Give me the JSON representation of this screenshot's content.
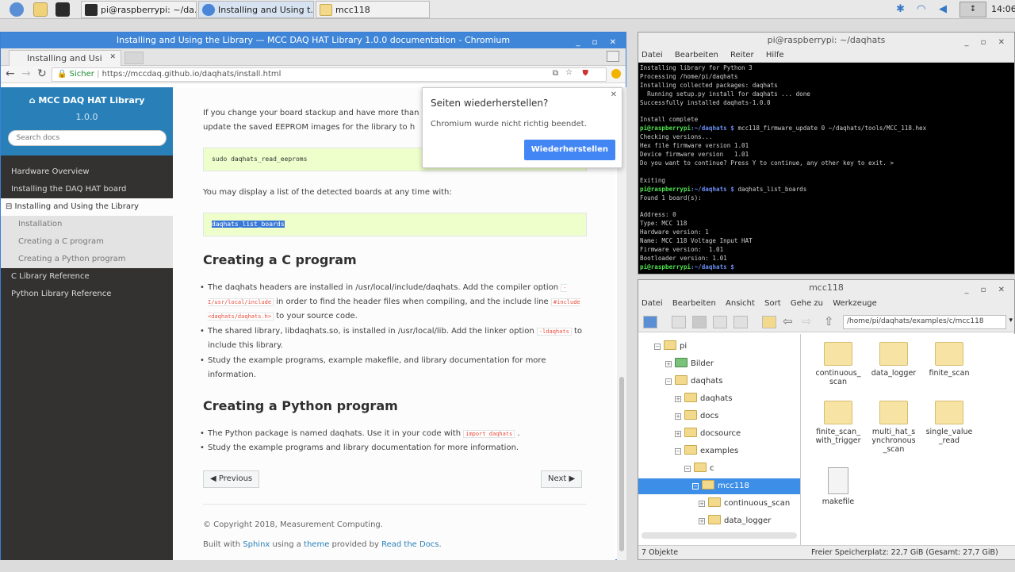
{
  "taskbar": {
    "tasks": [
      {
        "label": "pi@raspberrypi: ~/da..."
      },
      {
        "label": "Installing and Using t..."
      },
      {
        "label": "mcc118"
      }
    ],
    "clock": "14:06",
    "tray_text": "↕"
  },
  "browser": {
    "window_title": "Installing and Using the Library — MCC DAQ HAT Library 1.0.0 documentation - Chromium",
    "tab_label": "Installing and Usi",
    "secure_label": "Sicher",
    "url": "https://mccdaq.github.io/daqhats/install.html",
    "sidebar": {
      "title": "MCC DAQ HAT Library",
      "version": "1.0.0",
      "search_placeholder": "Search docs",
      "items": [
        {
          "label": "Hardware Overview"
        },
        {
          "label": "Installing the DAQ HAT board"
        },
        {
          "label": "⊟ Installing and Using the Library"
        }
      ],
      "sub_items": [
        {
          "label": "Installation"
        },
        {
          "label": "Creating a C program"
        },
        {
          "label": "Creating a Python program"
        }
      ],
      "items2": [
        {
          "label": "C Library Reference"
        },
        {
          "label": "Python Library Reference"
        }
      ]
    },
    "content": {
      "intro_line1": "If you change your board stackup and have more than",
      "intro_line2": "update the saved EEPROM images for the library to h",
      "code1": "sudo daqhats_read_eeproms",
      "list_text": "You may display a list of the detected boards at any time with:",
      "code2": "daqhats_list_boards",
      "h_c": "Creating a C program",
      "c_bullets": [
        {
          "a": "The daqhats headers are installed in /usr/local/include/daqhats. Add the compiler option",
          "code": "-I/usr/local/include",
          "b": "in order to find the header files when compiling, and the include line",
          "code2": "#include <daqhats/daqhats.h>",
          "c": "to your source code."
        },
        {
          "a": "The shared library, libdaqhats.so, is installed in /usr/local/lib. Add the linker option",
          "code": "-ldaqhats",
          "b": "to include this library."
        },
        {
          "a": "Study the example programs, example makefile, and library documentation for more information."
        }
      ],
      "h_py": "Creating a Python program",
      "py_bullets": [
        {
          "a": "The Python package is named daqhats. Use it in your code with",
          "code": "import daqhats",
          "b": "."
        },
        {
          "a": "Study the example programs and library documentation for more information."
        }
      ],
      "prev_label": "Previous",
      "next_label": "Next",
      "copyright": "© Copyright 2018, Measurement Computing.",
      "built_pre": "Built with",
      "built_sphinx": "Sphinx",
      "built_mid": "using a",
      "built_theme": "theme",
      "built_mid2": "provided by",
      "built_rtd": "Read the Docs",
      "built_end": "."
    },
    "popup": {
      "title": "Seiten wiederherstellen?",
      "message": "Chromium wurde nicht richtig beendet.",
      "button": "Wiederherstellen"
    }
  },
  "terminal": {
    "title": "pi@raspberrypi: ~/daqhats",
    "menu": [
      {
        "label": "Datei"
      },
      {
        "label": "Bearbeiten"
      },
      {
        "label": "Reiter"
      },
      {
        "label": "Hilfe"
      }
    ],
    "lines": [
      {
        "text": "Installing library for Python 3"
      },
      {
        "text": "Processing /home/pi/daqhats"
      },
      {
        "text": "Installing collected packages: daqhats"
      },
      {
        "text": "  Running setup.py install for daqhats ... done"
      },
      {
        "text": "Successfully installed daqhats-1.0.0"
      },
      {
        "text": ""
      },
      {
        "text": "Install complete"
      },
      {
        "prompt": "pi@raspberrypi",
        "path": ":~/daqhats $",
        "cmd": " mcc118_firmware_update 0 ~/daqhats/tools/MCC_118.hex"
      },
      {
        "text": "Checking versions..."
      },
      {
        "text": "Hex file firmware version 1.01"
      },
      {
        "text": "Device firmware version   1.01"
      },
      {
        "text": "Do you want to continue? Press Y to continue, any other key to exit. >"
      },
      {
        "text": ""
      },
      {
        "text": "Exiting"
      },
      {
        "prompt": "pi@raspberrypi",
        "path": ":~/daqhats $",
        "cmd": " daqhats_list_boards"
      },
      {
        "text": "Found 1 board(s):"
      },
      {
        "text": ""
      },
      {
        "text": "Address: 0"
      },
      {
        "text": "Type: MCC 118"
      },
      {
        "text": "Hardware version: 1"
      },
      {
        "text": "Name: MCC 118 Voltage Input HAT"
      },
      {
        "text": "Firmware version:  1.01"
      },
      {
        "text": "Bootloader version: 1.01"
      },
      {
        "prompt": "pi@raspberrypi",
        "path": ":~/daqhats $",
        "cmd": " "
      }
    ]
  },
  "filemanager": {
    "title": "mcc118",
    "menu": [
      {
        "label": "Datei"
      },
      {
        "label": "Bearbeiten"
      },
      {
        "label": "Ansicht"
      },
      {
        "label": "Sort"
      },
      {
        "label": "Gehe zu"
      },
      {
        "label": "Werkzeuge"
      }
    ],
    "path": "/home/pi/daqhats/examples/c/mcc118",
    "tree": [
      {
        "label": "pi"
      },
      {
        "label": "Bilder"
      },
      {
        "label": "daqhats"
      },
      {
        "label": "daqhats"
      },
      {
        "label": "docs"
      },
      {
        "label": "docsource"
      },
      {
        "label": "examples"
      },
      {
        "label": "c"
      },
      {
        "label": "mcc118"
      },
      {
        "label": "continuous_scan"
      },
      {
        "label": "data_logger"
      }
    ],
    "files": [
      {
        "label": "continuous_\nscan"
      },
      {
        "label": "data_logger"
      },
      {
        "label": "finite_scan"
      },
      {
        "label": "finite_scan_\nwith_trigger"
      },
      {
        "label": "multi_hat_s\nynchronous\n_scan"
      },
      {
        "label": "single_value\n_read"
      },
      {
        "label": "makefile"
      }
    ],
    "status_left": "7 Objekte",
    "status_right": "Freier Speicherplatz: 22,7 GiB (Gesamt: 27,7 GiB)"
  },
  "colors": {
    "accent": "#2980b9",
    "sidebar_bg": "#343131",
    "code_bg": "#eeffcc",
    "prompt": "#4ee44e"
  }
}
